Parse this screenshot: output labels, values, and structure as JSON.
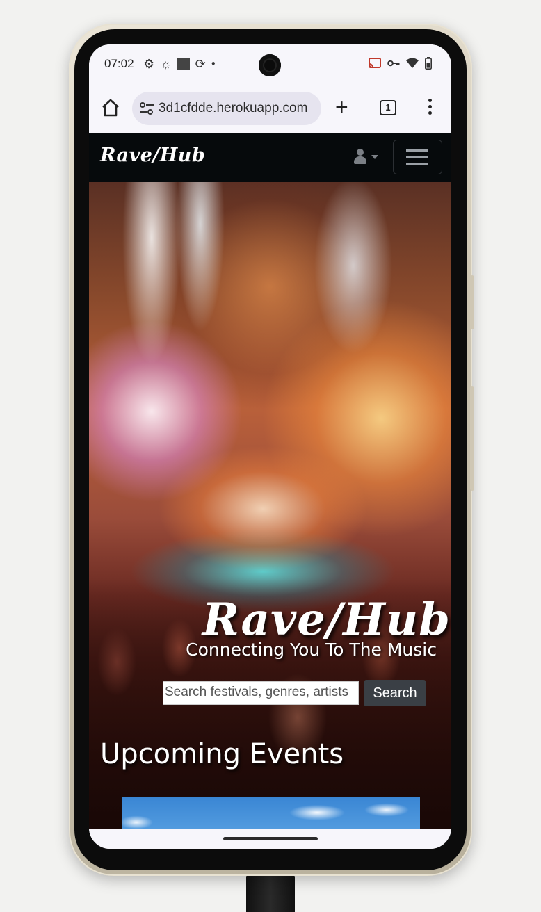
{
  "status_bar": {
    "time": "07:02",
    "left_icons": [
      "settings-gear-icon",
      "settings-outline-icon",
      "square-app-icon",
      "sync-app-icon",
      "dot-icon"
    ],
    "right_icons": [
      "cast-icon",
      "vpn-key-icon",
      "wifi-icon",
      "battery-icon"
    ]
  },
  "browser": {
    "url": "3d1cfdde.herokuapp.com",
    "tab_count": "1"
  },
  "site_nav": {
    "brand": "Rave/Hub"
  },
  "hero": {
    "title": "Rave/Hub",
    "subtitle": "Connecting You To The Music",
    "search_placeholder": "Search festivals, genres, artists",
    "search_button": "Search"
  },
  "events": {
    "heading": "Upcoming Events"
  }
}
